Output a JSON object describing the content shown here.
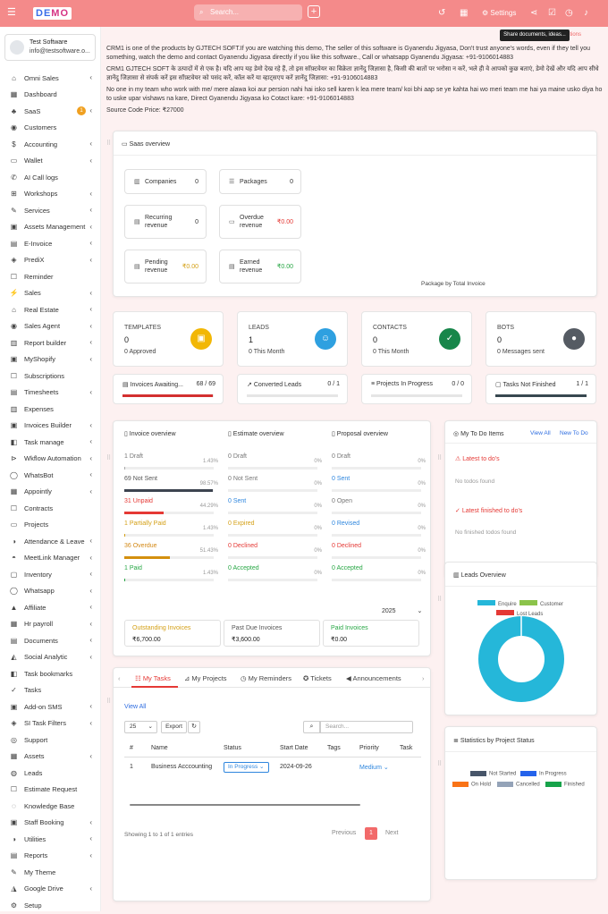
{
  "topbar": {
    "logo_a": "DE",
    "logo_b": "MO",
    "search_placeholder": "Search...",
    "settings_label": "Settings",
    "tooltip": "Share documents, ideas...",
    "tooltip_extra": "ptions"
  },
  "user": {
    "name": "Test Software",
    "email": "info@testsoftware.o..."
  },
  "sidebar": {
    "saas_badge": "1",
    "items": [
      {
        "label": "Omni Sales",
        "chev": true
      },
      {
        "label": "Dashboard",
        "chev": false
      },
      {
        "label": "SaaS",
        "chev": true
      },
      {
        "label": "Customers",
        "chev": false
      },
      {
        "label": "Accounting",
        "chev": true
      },
      {
        "label": "Wallet",
        "chev": true
      },
      {
        "label": "AI Call logs",
        "chev": false
      },
      {
        "label": "Workshops",
        "chev": true
      },
      {
        "label": "Services",
        "chev": true
      },
      {
        "label": "Assets Management",
        "chev": true
      },
      {
        "label": "E-Invoice",
        "chev": true
      },
      {
        "label": "PrediX",
        "chev": true
      },
      {
        "label": "Reminder",
        "chev": false
      },
      {
        "label": "Sales",
        "chev": true
      },
      {
        "label": "Real Estate",
        "chev": true
      },
      {
        "label": "Sales Agent",
        "chev": true
      },
      {
        "label": "Report builder",
        "chev": true
      },
      {
        "label": "MyShopify",
        "chev": true
      },
      {
        "label": "Subscriptions",
        "chev": false
      },
      {
        "label": "Timesheets",
        "chev": true
      },
      {
        "label": "Expenses",
        "chev": false
      },
      {
        "label": "Invoices Builder",
        "chev": true
      },
      {
        "label": "Task manage",
        "chev": true
      },
      {
        "label": "Wkflow Automation",
        "chev": true
      },
      {
        "label": "WhatsBot",
        "chev": true
      },
      {
        "label": "Appointly",
        "chev": true
      },
      {
        "label": "Contracts",
        "chev": false
      },
      {
        "label": "Projects",
        "chev": false
      },
      {
        "label": "Attendance & Leave",
        "chev": true
      },
      {
        "label": "MeetLink Manager",
        "chev": true
      },
      {
        "label": "Inventory",
        "chev": true
      },
      {
        "label": "Whatsapp",
        "chev": true
      },
      {
        "label": "Affiliate",
        "chev": true
      },
      {
        "label": "Hr payroll",
        "chev": true
      },
      {
        "label": "Documents",
        "chev": true
      },
      {
        "label": "Social Analytic",
        "chev": true
      },
      {
        "label": "Task bookmarks",
        "chev": false
      },
      {
        "label": "Tasks",
        "chev": false
      },
      {
        "label": "Add-on SMS",
        "chev": true
      },
      {
        "label": "SI Task Filters",
        "chev": true
      },
      {
        "label": "Support",
        "chev": false
      },
      {
        "label": "Assets",
        "chev": true
      },
      {
        "label": "Leads",
        "chev": false
      },
      {
        "label": "Estimate Request",
        "chev": false
      },
      {
        "label": "Knowledge Base",
        "chev": false
      },
      {
        "label": "Staff Booking",
        "chev": true
      },
      {
        "label": "Utilities",
        "chev": true
      },
      {
        "label": "Reports",
        "chev": true
      },
      {
        "label": "My Theme",
        "chev": false
      },
      {
        "label": "Google Drive",
        "chev": true
      },
      {
        "label": "Setup",
        "chev": false
      }
    ]
  },
  "intro": {
    "p1": "CRM1 is one of the products by GJTECH SOFT.If you are watching this demo, The seller of this software is Gyanendu Jigyasa, Don't trust anyone's words, even if they tell you something, watch the demo and contact Gyanendu Jigyasa directly if you like this software., Call or whatsapp Gyanendu Jigyasa: +91-9106014883",
    "p2": "CRM1 GJTECH SOFT के उत्पादों में से एक है। यदि आप यह डेमो देख रहे हैं, तो इस सॉफ़्टवेयर का विक्रेता ज्ञानेंदु जिज्ञासा है, किसी की बातों पर भरोसा न करें, भले ही वे आपको कुछ बताएं, डेमो देखें और यदि आप सीधे ज्ञानेंदु जिज्ञासा से संपर्क करें इस सॉफ़्टवेयर को पसंद करें, कॉल करें या व्हाट्सएप करें ज्ञानेंदु जिज्ञासा: +91-9106014883",
    "p3": "No one in my team who work with me/ mere alawa koi aur persion nahi hai isko sell karen k lea mere team/ koi bhi aap se ye kahta hai wo meri team me hai ya maine usko diya ho to uske upar vishaws na kare, Direct Gyanendu Jigyasa ko Cotact kare: +91-9106014883",
    "p4": "Source Code Price: ₹27000"
  },
  "saas": {
    "title": "Saas overview",
    "boxes": [
      {
        "label": "Companies",
        "value": "0",
        "color": "#333"
      },
      {
        "label": "Packages",
        "value": "0",
        "color": "#333"
      },
      {
        "label": "Recurring revenue",
        "value": "0",
        "color": "#333"
      },
      {
        "label": "Overdue revenue",
        "value": "₹0.00",
        "color": "#e53935"
      },
      {
        "label": "Pending revenue",
        "value": "₹0.00",
        "color": "#d4a017"
      },
      {
        "label": "Earned revenue",
        "value": "₹0.00",
        "color": "#28a745"
      }
    ],
    "chart_label": "Package by Total Invoice"
  },
  "stats": [
    {
      "label": "TEMPLATES",
      "value": "0",
      "sub": "0 Approved",
      "color": "#f2b705",
      "icon": "▣"
    },
    {
      "label": "LEADS",
      "value": "1",
      "sub": "0 This Month",
      "color": "#2ea0e0",
      "icon": "☺"
    },
    {
      "label": "CONTACTS",
      "value": "0",
      "sub": "0 This Month",
      "color": "#17864a",
      "icon": "✓"
    },
    {
      "label": "BOTS",
      "value": "0",
      "sub": "0 Messages sent",
      "color": "#555b63",
      "icon": "●"
    }
  ],
  "progress": [
    {
      "label": "Invoices Awaiting...",
      "value": "68 / 69",
      "fill": 98.6,
      "color": "#d32f2f",
      "icon": "▤"
    },
    {
      "label": "Converted Leads",
      "value": "0 / 1",
      "fill": 0,
      "color": "#999",
      "icon": "↗"
    },
    {
      "label": "Projects In Progress",
      "value": "0 / 0",
      "fill": 0,
      "color": "#999",
      "icon": "≡"
    },
    {
      "label": "Tasks Not Finished",
      "value": "1 / 1",
      "fill": 100,
      "color": "#37474f",
      "icon": "▢"
    }
  ],
  "overview": {
    "columns": [
      {
        "title": "Invoice overview",
        "rows": [
          {
            "label": "1 Draft",
            "pct": "1.43%",
            "fill": 1.43,
            "color": "#777",
            "bar": "#aaa"
          },
          {
            "label": "69 Not Sent",
            "pct": "98.57%",
            "fill": 98.57,
            "color": "#555",
            "bar": "#3d4450"
          },
          {
            "label": "31 Unpaid",
            "pct": "44.29%",
            "fill": 44.29,
            "color": "#e53935",
            "bar": "#e53935"
          },
          {
            "label": "1 Partially Paid",
            "pct": "1.43%",
            "fill": 1.43,
            "color": "#d4a017",
            "bar": "#d4a017"
          },
          {
            "label": "36 Overdue",
            "pct": "51.43%",
            "fill": 51.43,
            "color": "#d48a17",
            "bar": "#d4900f"
          },
          {
            "label": "1 Paid",
            "pct": "1.43%",
            "fill": 1.43,
            "color": "#28a745",
            "bar": "#28a745"
          }
        ]
      },
      {
        "title": "Estimate overview",
        "rows": [
          {
            "label": "0 Draft",
            "pct": "0%",
            "fill": 0,
            "color": "#777",
            "bar": "#aaa"
          },
          {
            "label": "0 Not Sent",
            "pct": "0%",
            "fill": 0,
            "color": "#777",
            "bar": "#aaa"
          },
          {
            "label": "0 Sent",
            "pct": "0%",
            "fill": 0,
            "color": "#2e86de",
            "bar": "#2e86de"
          },
          {
            "label": "0 Expired",
            "pct": "0%",
            "fill": 0,
            "color": "#d4a017",
            "bar": "#d4a017"
          },
          {
            "label": "0 Declined",
            "pct": "0%",
            "fill": 0,
            "color": "#e53935",
            "bar": "#e53935"
          },
          {
            "label": "0 Accepted",
            "pct": "0%",
            "fill": 0,
            "color": "#28a745",
            "bar": "#28a745"
          }
        ]
      },
      {
        "title": "Proposal overview",
        "rows": [
          {
            "label": "0 Draft",
            "pct": "0%",
            "fill": 0,
            "color": "#777",
            "bar": "#aaa"
          },
          {
            "label": "0 Sent",
            "pct": "0%",
            "fill": 0,
            "color": "#2e86de",
            "bar": "#2e86de"
          },
          {
            "label": "0 Open",
            "pct": "0%",
            "fill": 0,
            "color": "#777",
            "bar": "#aaa"
          },
          {
            "label": "0 Revised",
            "pct": "0%",
            "fill": 0,
            "color": "#2e86de",
            "bar": "#2e86de"
          },
          {
            "label": "0 Declined",
            "pct": "0%",
            "fill": 0,
            "color": "#e53935",
            "bar": "#e53935"
          },
          {
            "label": "0 Accepted",
            "pct": "0%",
            "fill": 0,
            "color": "#28a745",
            "bar": "#28a745"
          }
        ]
      }
    ],
    "year": "2025",
    "summary": [
      {
        "label": "Outstanding Invoices",
        "value": "₹6,700.00",
        "color": "#d4a017"
      },
      {
        "label": "Past Due Invoices",
        "value": "₹3,600.00",
        "color": "#555"
      },
      {
        "label": "Paid Invoices",
        "value": "₹0.00",
        "color": "#28a745"
      }
    ]
  },
  "todo": {
    "title": "My To Do Items",
    "view_all": "View All",
    "new": "New To Do",
    "latest": "Latest to do's",
    "no_todos": "No todos found",
    "finished": "Latest finished to do's",
    "no_finished": "No finished todos found"
  },
  "leads": {
    "title": "Leads Overview"
  },
  "chart_data": {
    "type": "pie",
    "categories": [
      "Enquire",
      "Customer",
      "Lost Leads"
    ],
    "values": [
      1,
      0,
      0
    ],
    "colors": [
      "#25b7d9",
      "#8bc34a",
      "#e53935"
    ]
  },
  "project_status": {
    "title": "Statistics by Project Status",
    "legend": [
      {
        "label": "Not Started",
        "color": "#475569"
      },
      {
        "label": "In Progress",
        "color": "#2563eb"
      },
      {
        "label": "On Hold",
        "color": "#f97316"
      },
      {
        "label": "Cancelled",
        "color": "#94a3b8"
      },
      {
        "label": "Finished",
        "color": "#16a34a"
      }
    ]
  },
  "tasks": {
    "tabs": [
      "My Tasks",
      "My Projects",
      "My Reminders",
      "Tickets",
      "Announcements"
    ],
    "view_all": "View All",
    "page_size": "25",
    "export": "Export",
    "search_placeholder": "Search...",
    "headers": [
      "#",
      "Name",
      "Status",
      "Start Date",
      "Tags",
      "Priority",
      "Task"
    ],
    "rows": [
      {
        "num": "1",
        "name": "Business Acccounting",
        "status": "In Progress",
        "date": "2024-09-26",
        "priority": "Medium"
      }
    ],
    "info": "Showing 1 to 1 of 1 entries",
    "prev": "Previous",
    "page": "1",
    "next": "Next"
  }
}
